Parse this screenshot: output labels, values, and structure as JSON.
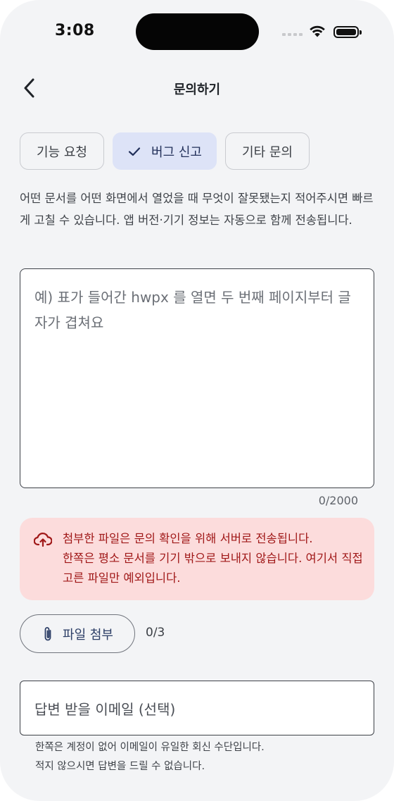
{
  "status_bar": {
    "time": "3:08"
  },
  "header": {
    "title": "문의하기"
  },
  "categories": [
    {
      "label": "기능 요청",
      "selected": false
    },
    {
      "label": "버그 신고",
      "selected": true
    },
    {
      "label": "기타 문의",
      "selected": false
    }
  ],
  "description": "어떤 문서를 어떤 화면에서 열었을 때 무엇이 잘못됐는지 적어주시면 빠르게 고칠 수 있습니다. 앱 버전·기기 정보는 자동으로 함께 전송됩니다.",
  "message": {
    "placeholder": "예) 표가 들어간 hwpx 를 열면 두 번째 페이지부터 글자가 겹쳐요",
    "counter": "0/2000"
  },
  "notice": {
    "line1": "첨부한 파일은 문의 확인을 위해 서버로 전송됩니다.",
    "line2": "한쪽은 평소 문서를 기기 밖으로 보내지 않습니다. 여기서 직접 고른 파일만 예외입니다.",
    "color": "#a01818",
    "background": "#fcdcdc"
  },
  "attach": {
    "label": "파일 첨부",
    "count": "0/3"
  },
  "email": {
    "placeholder": "답변 받을 이메일 (선택)",
    "hint_line1": "한쪽은 계정이 없어 이메일이 유일한 회신 수단입니다.",
    "hint_line2": "적지 않으시면 답변을 드릴 수 없습니다."
  },
  "icons": {
    "back": "chevron-left-icon",
    "check": "check-icon",
    "upload": "cloud-upload-icon",
    "attach": "paperclip-icon"
  },
  "colors": {
    "selected_chip": "#dde3f7",
    "background": "#f3f4f6"
  }
}
